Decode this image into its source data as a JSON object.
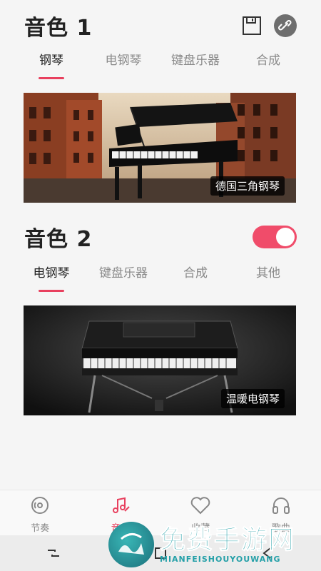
{
  "section1": {
    "title": "音色 1",
    "tabs": [
      "钢琴",
      "电钢琴",
      "键盘乐器",
      "合成"
    ],
    "active_tab": 0,
    "banner_label": "德国三角钢琴"
  },
  "section2": {
    "title": "音色 2",
    "toggle_on": true,
    "tabs": [
      "电钢琴",
      "键盘乐器",
      "合成",
      "其他"
    ],
    "active_tab": 0,
    "banner_label": "温暖电钢琴"
  },
  "bottom_nav": [
    {
      "label": "节奏",
      "icon": "metronome-icon",
      "active": false
    },
    {
      "label": "音色",
      "icon": "music-note-icon",
      "active": true
    },
    {
      "label": "收藏",
      "icon": "heart-icon",
      "active": false
    },
    {
      "label": "歌曲",
      "icon": "headphones-icon",
      "active": false
    }
  ],
  "watermark": {
    "title": "免费手游网",
    "subtitle": "MIANFEISHOUYOUWANG"
  },
  "colors": {
    "accent": "#e8405e",
    "toggle": "#f04c6a"
  }
}
